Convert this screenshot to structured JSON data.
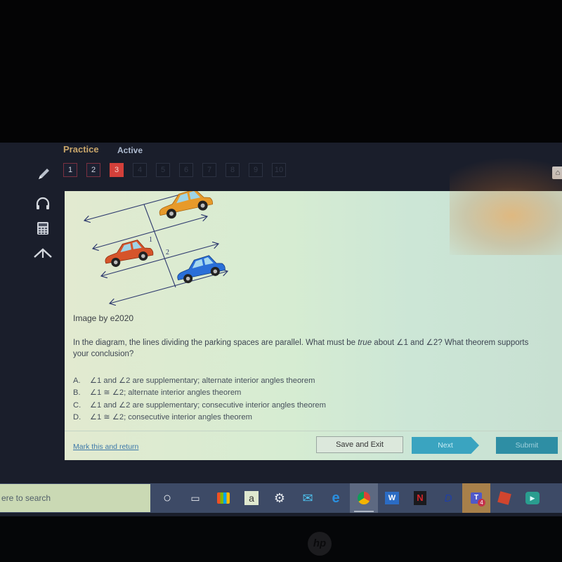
{
  "header": {
    "tabs": [
      {
        "label": "Practice",
        "state": "selected"
      },
      {
        "label": "Active",
        "state": "default"
      }
    ],
    "question_nav": [
      {
        "label": "1",
        "state": "visited"
      },
      {
        "label": "2",
        "state": "visited"
      },
      {
        "label": "3",
        "state": "current"
      },
      {
        "label": "4",
        "state": "unvisited"
      },
      {
        "label": "5",
        "state": "unvisited"
      },
      {
        "label": "6",
        "state": "unvisited"
      },
      {
        "label": "7",
        "state": "unvisited"
      },
      {
        "label": "8",
        "state": "unvisited"
      },
      {
        "label": "9",
        "state": "unvisited"
      },
      {
        "label": "10",
        "state": "unvisited"
      }
    ],
    "left_tool_icon": "pencil-icon",
    "right_tool_icon": "eraser-icon"
  },
  "side_tools": [
    {
      "name": "headphones-icon"
    },
    {
      "name": "calculator-icon"
    },
    {
      "name": "collapse-up-icon"
    }
  ],
  "diagram": {
    "angle_labels": [
      "1",
      "2"
    ],
    "cars": [
      "orange",
      "red-orange",
      "blue"
    ],
    "colors": {
      "orange_car": "#e79a2a",
      "red_car": "#d6542a",
      "blue_car": "#2a6fd8",
      "lines": "#2e3a6e"
    }
  },
  "content": {
    "credit": "Image by e2020",
    "question_part1": "In the diagram, the lines dividing the parking spaces are parallel. What must be ",
    "question_emph": "true",
    "question_part2": " about ∠1 and ∠2? What theorem supports your conclusion?",
    "choices": [
      {
        "letter": "A.",
        "text": "∠1 and ∠2 are supplementary; alternate interior angles theorem"
      },
      {
        "letter": "B.",
        "text": "∠1 ≅ ∠2; alternate interior angles theorem"
      },
      {
        "letter": "C.",
        "text": "∠1 and ∠2 are supplementary; consecutive interior angles theorem"
      },
      {
        "letter": "D.",
        "text": "∠1 ≅ ∠2; consecutive interior angles theorem"
      }
    ]
  },
  "footer": {
    "mark_link": "Mark this and return",
    "save_exit": "Save and Exit",
    "next": "Next",
    "submit": "Submit"
  },
  "taskbar": {
    "search_text": "ere to search",
    "icons": [
      {
        "name": "cortana-icon",
        "glyph": "○"
      },
      {
        "name": "task-view-icon",
        "glyph": "▭"
      },
      {
        "name": "store-icon",
        "glyph": "🛍"
      },
      {
        "name": "amazon-icon",
        "glyph": "a"
      },
      {
        "name": "settings-icon",
        "glyph": "⚙"
      },
      {
        "name": "mail-icon",
        "glyph": "✉"
      },
      {
        "name": "edge-icon",
        "glyph": "e"
      },
      {
        "name": "chrome-icon",
        "glyph": "◉"
      },
      {
        "name": "word-icon",
        "glyph": "W"
      },
      {
        "name": "netflix-icon",
        "glyph": "N"
      },
      {
        "name": "disney-plus-icon",
        "glyph": "D"
      },
      {
        "name": "teams-icon",
        "glyph": "T",
        "badge": "4"
      },
      {
        "name": "roblox-icon",
        "glyph": "■"
      },
      {
        "name": "meet-icon",
        "glyph": "▶"
      }
    ]
  },
  "hardware": {
    "logo": "hp"
  }
}
